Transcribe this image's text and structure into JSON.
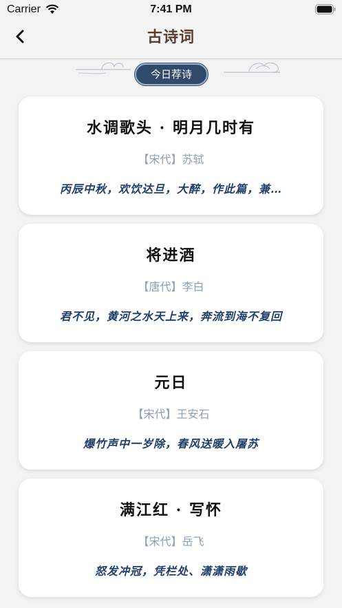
{
  "status_bar": {
    "carrier": "Carrier",
    "time": "7:41 PM"
  },
  "nav": {
    "back_icon": "chevron-left-icon",
    "title": "古诗词"
  },
  "section": {
    "badge": "今日荐诗"
  },
  "colors": {
    "accent": "#2f4a6b",
    "title_brown": "#5a3f30",
    "author_gray": "#8aa0b6",
    "line_blue": "#1f3f6a"
  },
  "poems": [
    {
      "title": "水调歌头 · 明月几时有",
      "author": "【宋代】苏轼",
      "line": "丙辰中秋，欢饮达旦，大醉，作此篇，兼…"
    },
    {
      "title": "将进酒",
      "author": "【唐代】李白",
      "line": "君不见，黄河之水天上来，奔流到海不复回"
    },
    {
      "title": "元日",
      "author": "【宋代】王安石",
      "line": "爆竹声中一岁除，春风送暖入屠苏"
    },
    {
      "title": "满江红 · 写怀",
      "author": "【宋代】岳飞",
      "line": "怒发冲冠，凭栏处、潇潇雨歇"
    }
  ]
}
